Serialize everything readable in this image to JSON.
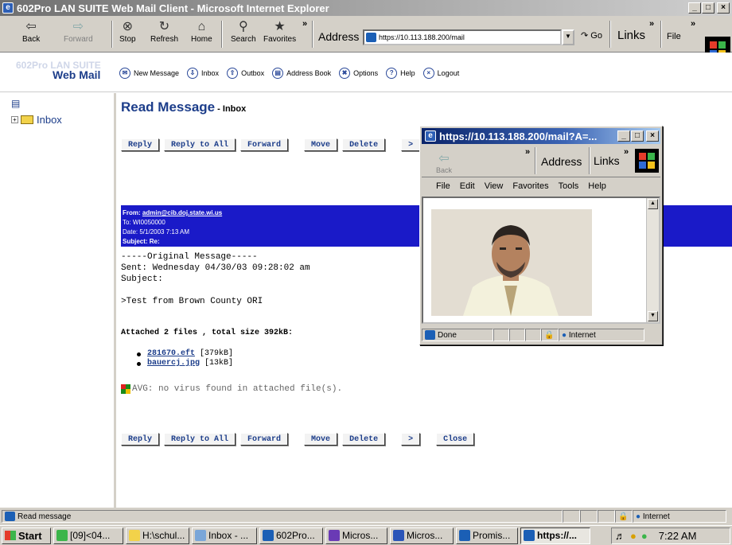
{
  "window": {
    "title": "602Pro LAN SUITE Web Mail Client - Microsoft Internet Explorer",
    "controls": [
      "_",
      "□",
      "×"
    ]
  },
  "toolbar": {
    "back": "Back",
    "forward": "Forward",
    "stop": "Stop",
    "refresh": "Refresh",
    "home": "Home",
    "search": "Search",
    "favorites": "Favorites",
    "address_label": "Address",
    "address_value": "https://10.113.188.200/mail",
    "go": "Go",
    "links": "Links",
    "file": "File"
  },
  "webmail": {
    "brand_top": "602Pro LAN SUITE",
    "brand_main": "Web Mail",
    "nav": [
      "New Message",
      "Inbox",
      "Outbox",
      "Address Book",
      "Options",
      "Help",
      "Logout"
    ]
  },
  "sidebar": {
    "inbox": "Inbox"
  },
  "message": {
    "title": "Read Message",
    "folder": " - Inbox",
    "buttons_top": [
      "Reply",
      "Reply to All",
      "Forward",
      "Move",
      "Delete",
      ">"
    ],
    "buttons_bottom": [
      "Reply",
      "Reply to All",
      "Forward",
      "Move",
      "Delete",
      ">",
      "Close"
    ],
    "from_label": "From:",
    "from": "admin@cib.doj.state.wi.us",
    "to": "To: WI0050000",
    "date": "Date: 5/1/2003 7:13 AM",
    "subject": "Subject: Re:",
    "body": [
      "-----Original Message-----",
      "Sent: Wednesday 04/30/03 09:28:02 am",
      "Subject:",
      "",
      ">Test from Brown County ORI"
    ],
    "attach_title": "Attached 2 files , total size 392kB:",
    "attachments": [
      {
        "name": "281670.eft",
        "size": "[379kB]"
      },
      {
        "name": "bauercj.jpg",
        "size": "[13kB]"
      }
    ],
    "avg": "AVG: no virus found in attached file(s)."
  },
  "popup": {
    "title": "https://10.113.188.200/mail?A=...",
    "back": "Back",
    "address": "Address",
    "links": "Links",
    "menu": [
      "File",
      "Edit",
      "View",
      "Favorites",
      "Tools",
      "Help"
    ],
    "status": "Done",
    "zone": "Internet"
  },
  "statusbar": {
    "text": "Read message",
    "zone": "Internet"
  },
  "taskbar": {
    "start": "Start",
    "tasks": [
      "[09]<04...",
      "H:\\schul...",
      "Inbox - ...",
      "602Pro...",
      "Micros...",
      "Micros...",
      "Promis...",
      "https://..."
    ],
    "clock": "7:22 AM"
  }
}
